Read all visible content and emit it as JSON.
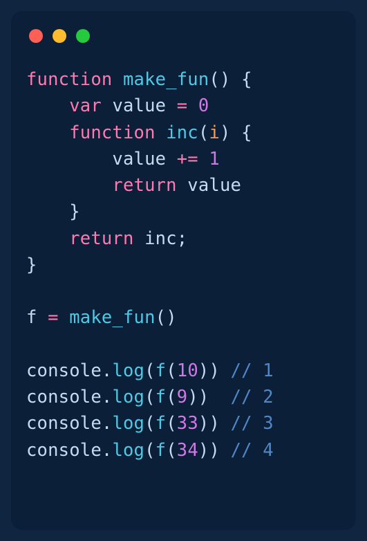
{
  "traffic_lights": {
    "red": "#ff5f56",
    "yellow": "#ffbd2e",
    "green": "#27c93f"
  },
  "code": {
    "lines": [
      [
        {
          "cls": "tok-keyword",
          "t": "function"
        },
        {
          "cls": "tok-ident",
          "t": " "
        },
        {
          "cls": "tok-fn",
          "t": "make_fun"
        },
        {
          "cls": "tok-punc",
          "t": "() {"
        }
      ],
      [
        {
          "cls": "tok-ident",
          "t": "    "
        },
        {
          "cls": "tok-keyword",
          "t": "var"
        },
        {
          "cls": "tok-ident",
          "t": " value "
        },
        {
          "cls": "tok-op",
          "t": "="
        },
        {
          "cls": "tok-ident",
          "t": " "
        },
        {
          "cls": "tok-num",
          "t": "0"
        }
      ],
      [
        {
          "cls": "tok-ident",
          "t": "    "
        },
        {
          "cls": "tok-keyword",
          "t": "function"
        },
        {
          "cls": "tok-ident",
          "t": " "
        },
        {
          "cls": "tok-fn",
          "t": "inc"
        },
        {
          "cls": "tok-punc",
          "t": "("
        },
        {
          "cls": "tok-param",
          "t": "i"
        },
        {
          "cls": "tok-punc",
          "t": ") {"
        }
      ],
      [
        {
          "cls": "tok-ident",
          "t": "        value "
        },
        {
          "cls": "tok-op",
          "t": "+="
        },
        {
          "cls": "tok-ident",
          "t": " "
        },
        {
          "cls": "tok-num",
          "t": "1"
        }
      ],
      [
        {
          "cls": "tok-ident",
          "t": "        "
        },
        {
          "cls": "tok-keyword",
          "t": "return"
        },
        {
          "cls": "tok-ident",
          "t": " value"
        }
      ],
      [
        {
          "cls": "tok-ident",
          "t": "    "
        },
        {
          "cls": "tok-punc",
          "t": "}"
        }
      ],
      [
        {
          "cls": "tok-ident",
          "t": "    "
        },
        {
          "cls": "tok-keyword",
          "t": "return"
        },
        {
          "cls": "tok-ident",
          "t": " inc"
        },
        {
          "cls": "tok-punc",
          "t": ";"
        }
      ],
      [
        {
          "cls": "tok-punc",
          "t": "}"
        }
      ],
      [
        {
          "cls": "tok-ident",
          "t": ""
        }
      ],
      [
        {
          "cls": "tok-ident",
          "t": "f "
        },
        {
          "cls": "tok-op",
          "t": "="
        },
        {
          "cls": "tok-ident",
          "t": " "
        },
        {
          "cls": "tok-fn",
          "t": "make_fun"
        },
        {
          "cls": "tok-punc",
          "t": "()"
        }
      ],
      [
        {
          "cls": "tok-ident",
          "t": ""
        }
      ],
      [
        {
          "cls": "tok-obj",
          "t": "console"
        },
        {
          "cls": "tok-punc",
          "t": "."
        },
        {
          "cls": "tok-prop",
          "t": "log"
        },
        {
          "cls": "tok-punc",
          "t": "("
        },
        {
          "cls": "tok-fn",
          "t": "f"
        },
        {
          "cls": "tok-punc",
          "t": "("
        },
        {
          "cls": "tok-num",
          "t": "10"
        },
        {
          "cls": "tok-punc",
          "t": ")) "
        },
        {
          "cls": "tok-comm",
          "t": "// 1"
        }
      ],
      [
        {
          "cls": "tok-obj",
          "t": "console"
        },
        {
          "cls": "tok-punc",
          "t": "."
        },
        {
          "cls": "tok-prop",
          "t": "log"
        },
        {
          "cls": "tok-punc",
          "t": "("
        },
        {
          "cls": "tok-fn",
          "t": "f"
        },
        {
          "cls": "tok-punc",
          "t": "("
        },
        {
          "cls": "tok-num",
          "t": "9"
        },
        {
          "cls": "tok-punc",
          "t": "))  "
        },
        {
          "cls": "tok-comm",
          "t": "// 2"
        }
      ],
      [
        {
          "cls": "tok-obj",
          "t": "console"
        },
        {
          "cls": "tok-punc",
          "t": "."
        },
        {
          "cls": "tok-prop",
          "t": "log"
        },
        {
          "cls": "tok-punc",
          "t": "("
        },
        {
          "cls": "tok-fn",
          "t": "f"
        },
        {
          "cls": "tok-punc",
          "t": "("
        },
        {
          "cls": "tok-num",
          "t": "33"
        },
        {
          "cls": "tok-punc",
          "t": ")) "
        },
        {
          "cls": "tok-comm",
          "t": "// 3"
        }
      ],
      [
        {
          "cls": "tok-obj",
          "t": "console"
        },
        {
          "cls": "tok-punc",
          "t": "."
        },
        {
          "cls": "tok-prop",
          "t": "log"
        },
        {
          "cls": "tok-punc",
          "t": "("
        },
        {
          "cls": "tok-fn",
          "t": "f"
        },
        {
          "cls": "tok-punc",
          "t": "("
        },
        {
          "cls": "tok-num",
          "t": "34"
        },
        {
          "cls": "tok-punc",
          "t": ")) "
        },
        {
          "cls": "tok-comm",
          "t": "// 4"
        }
      ]
    ]
  }
}
